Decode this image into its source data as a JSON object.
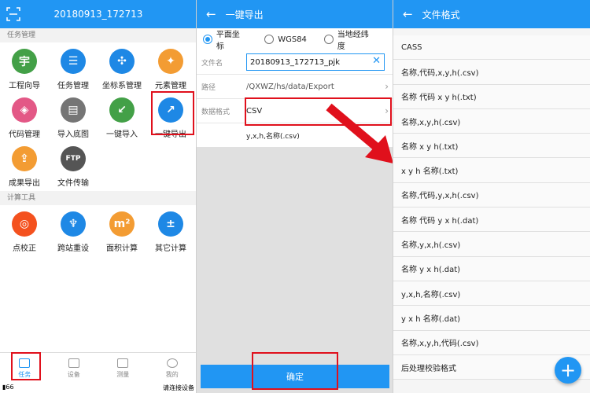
{
  "panel1": {
    "title": "20180913_172713",
    "section1": "任务管理",
    "section2": "计算工具",
    "tiles1": [
      {
        "label": "工程向导",
        "icon": "project-wizard-icon",
        "color": "#43A047",
        "glyph": "宇"
      },
      {
        "label": "任务管理",
        "icon": "task-list-icon",
        "color": "#1E88E5",
        "glyph": "☰"
      },
      {
        "label": "坐标系管理",
        "icon": "coordinate-icon",
        "color": "#1E88E5",
        "glyph": "✣"
      },
      {
        "label": "元素管理",
        "icon": "element-icon",
        "color": "#F39C33",
        "glyph": "✦"
      },
      {
        "label": "代码管理",
        "icon": "tag-icon",
        "color": "#E35886",
        "glyph": "◈"
      },
      {
        "label": "导入底图",
        "icon": "import-map-icon",
        "color": "#757575",
        "glyph": "▤"
      },
      {
        "label": "一键导入",
        "icon": "import-icon",
        "color": "#43A047",
        "glyph": "↙"
      },
      {
        "label": "一键导出",
        "icon": "export-icon",
        "color": "#1E88E5",
        "glyph": "↗"
      },
      {
        "label": "成果导出",
        "icon": "result-export-icon",
        "color": "#F39C33",
        "glyph": "⇪"
      },
      {
        "label": "文件传输",
        "icon": "ftp-icon",
        "color": "#555555",
        "glyph": "FTP"
      }
    ],
    "tiles2": [
      {
        "label": "点校正",
        "icon": "point-calibrate-icon",
        "color": "#F4511E",
        "glyph": "◎"
      },
      {
        "label": "跨站重设",
        "icon": "station-icon",
        "color": "#1E88E5",
        "glyph": "♆"
      },
      {
        "label": "面积计算",
        "icon": "area-icon",
        "color": "#F39C33",
        "glyph": "m²"
      },
      {
        "label": "其它计算",
        "icon": "calculator-icon",
        "color": "#1E88E5",
        "glyph": "±"
      }
    ],
    "nav": [
      {
        "label": "任务",
        "icon": "task-tab-icon"
      },
      {
        "label": "设备",
        "icon": "device-tab-icon"
      },
      {
        "label": "测量",
        "icon": "measure-tab-icon"
      },
      {
        "label": "我的",
        "icon": "profile-tab-icon"
      }
    ],
    "status_left": "66",
    "status_right": "请连接设备"
  },
  "panel2": {
    "title": "一键导出",
    "radios": [
      "平面坐标",
      "WGS84",
      "当地经纬度"
    ],
    "filename_label": "文件名",
    "filename_value": "20180913_172713_pjk",
    "path_label": "路径",
    "path_value": "/QXWZ/hs/data/Export",
    "format_label": "数据格式",
    "format_value": "CSV",
    "format_desc": "y,x,h,名称(.csv)",
    "confirm": "确定"
  },
  "panel3": {
    "title": "文件格式",
    "formats": [
      "CASS",
      "名称,代码,x,y,h(.csv)",
      "名称 代码 x y h(.txt)",
      "名称,x,y,h(.csv)",
      "名称 x y h(.txt)",
      "x y h 名称(.txt)",
      "名称,代码,y,x,h(.csv)",
      "名称 代码 y x h(.dat)",
      "名称,y,x,h(.csv)",
      "名称 y x h(.dat)",
      "y,x,h,名称(.csv)",
      "y x h 名称(.dat)",
      "名称,x,y,h,代码(.csv)",
      "后处理校验格式"
    ],
    "fab": "+"
  },
  "colors": {
    "primary": "#2196F3",
    "highlight": "#E0101C"
  }
}
